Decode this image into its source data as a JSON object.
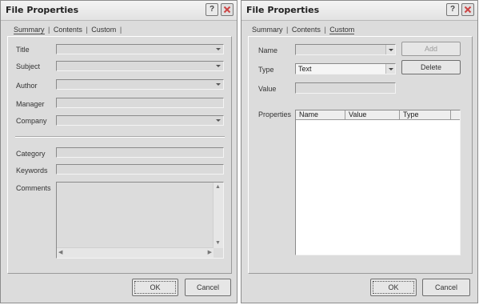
{
  "left_dialog": {
    "title": "File Properties",
    "help_label": "?",
    "tabs": [
      {
        "label": "Summary"
      },
      {
        "label": "Contents"
      },
      {
        "label": "Custom"
      }
    ],
    "labels": {
      "title": "Title",
      "subject": "Subject",
      "author": "Author",
      "manager": "Manager",
      "company": "Company",
      "category": "Category",
      "keywords": "Keywords",
      "comments": "Comments"
    },
    "ok_label": "OK",
    "cancel_label": "Cancel"
  },
  "right_dialog": {
    "title": "File Properties",
    "help_label": "?",
    "tabs": [
      {
        "label": "Summary"
      },
      {
        "label": "Contents"
      },
      {
        "label": "Custom"
      }
    ],
    "labels": {
      "name": "Name",
      "type": "Type",
      "value": "Value",
      "properties": "Properties"
    },
    "type_selected": "Text",
    "add_label": "Add",
    "delete_label": "Delete",
    "columns": [
      {
        "label": "Name"
      },
      {
        "label": "Value"
      },
      {
        "label": "Type"
      }
    ],
    "ok_label": "OK",
    "cancel_label": "Cancel"
  }
}
